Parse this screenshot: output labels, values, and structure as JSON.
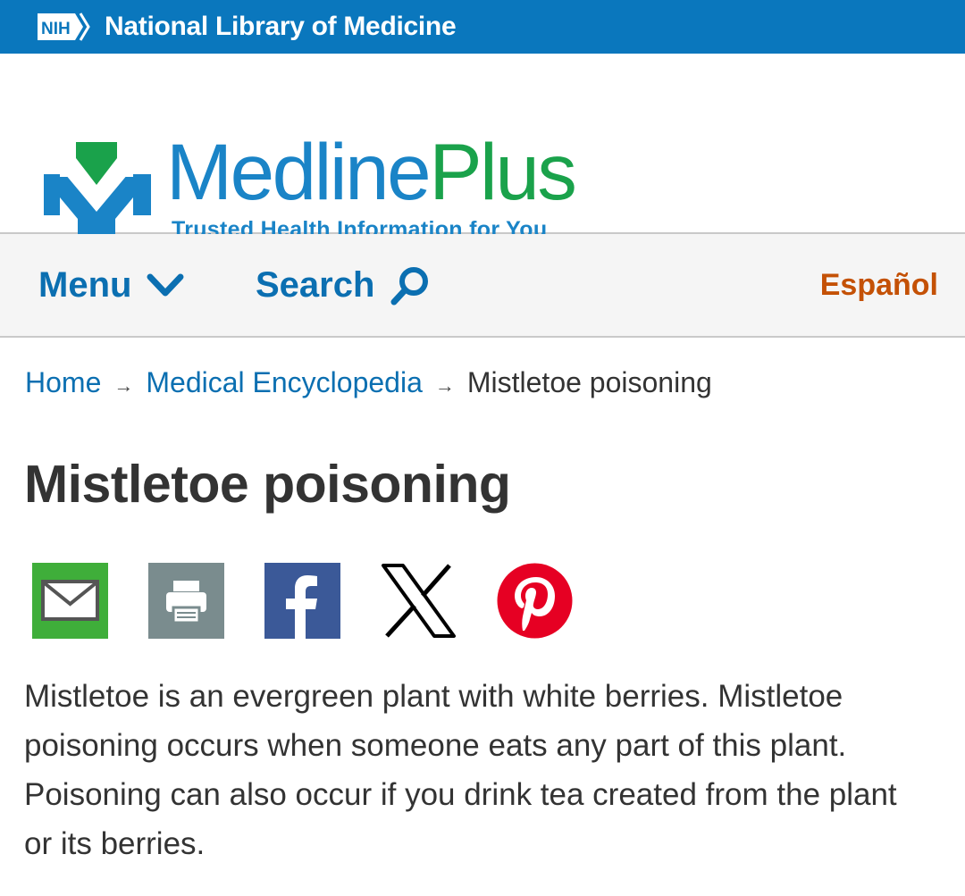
{
  "topbar": {
    "nih_badge": "NIH",
    "title": "National Library of Medicine"
  },
  "brand": {
    "name_part1": "Medline",
    "name_part2": "Plus",
    "tagline": "Trusted Health Information for You",
    "colors": {
      "blue": "#1a84c7",
      "green": "#1aa24b"
    }
  },
  "nav": {
    "menu_label": "Menu",
    "search_label": "Search",
    "language_label": "Español"
  },
  "breadcrumb": {
    "home": "Home",
    "encyclopedia": "Medical Encyclopedia",
    "current": "Mistletoe poisoning",
    "separator": "→"
  },
  "page": {
    "title": "Mistletoe poisoning",
    "intro": "Mistletoe is an evergreen plant with white berries. Mistletoe poisoning occurs when someone eats any part of this plant. Poisoning can also occur if you drink tea created from the plant or its berries."
  },
  "share": {
    "icons": [
      "email-icon",
      "print-icon",
      "facebook-icon",
      "x-icon",
      "pinterest-icon"
    ],
    "colors": {
      "email": "#3fae3a",
      "print": "#7a8c8e",
      "facebook": "#3b5998",
      "x": "#000000",
      "pinterest": "#e60023"
    }
  },
  "colors": {
    "topbar": "#0a77bd",
    "link": "#0b6fb1",
    "spanish": "#c45106",
    "text": "#333333"
  }
}
